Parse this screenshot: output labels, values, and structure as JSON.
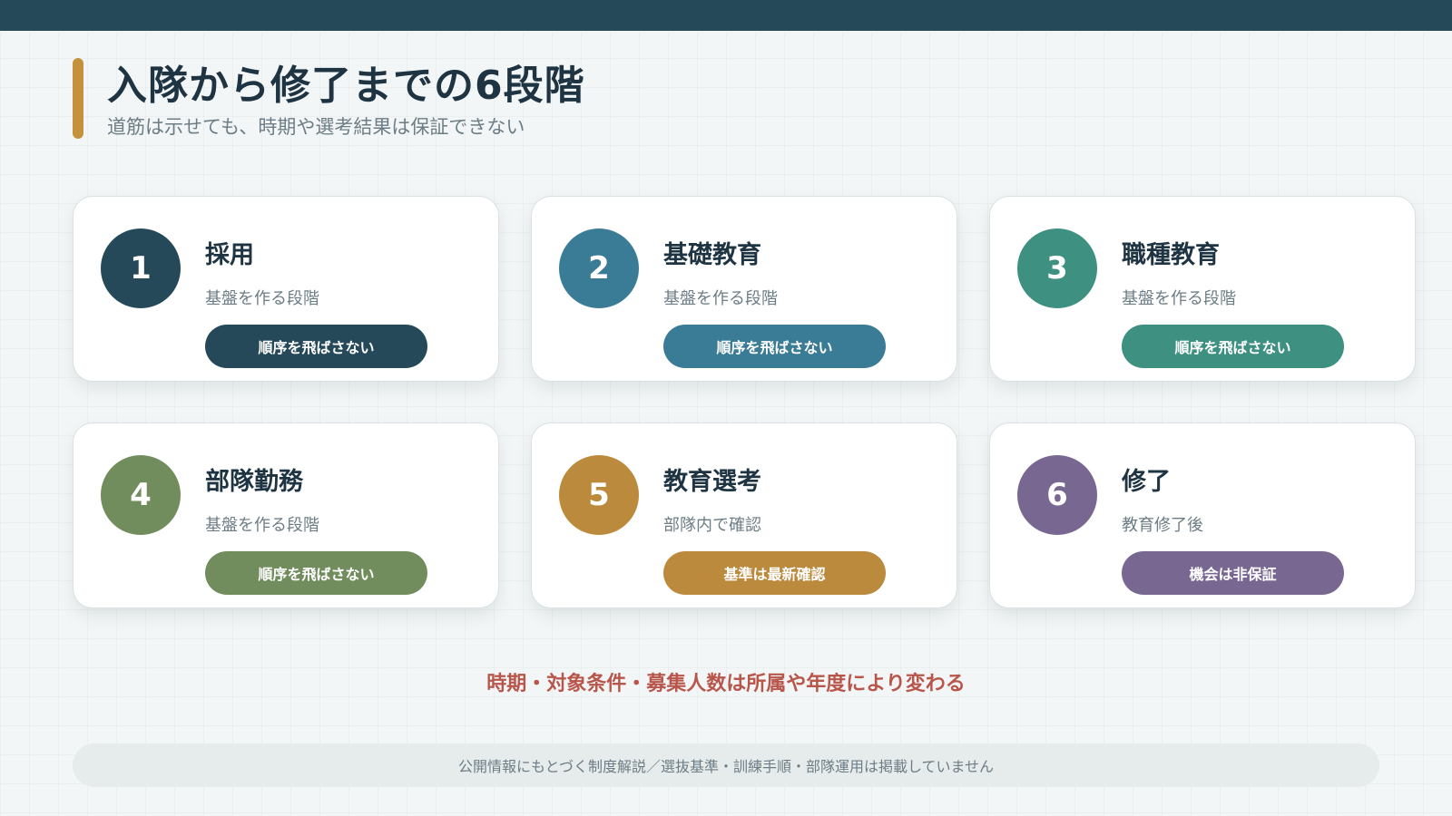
{
  "header": {
    "title": "入隊から修了までの6段階",
    "subtitle": "道筋は示せても、時期や選考結果は保証できない"
  },
  "colors": {
    "top_bar": "#26495a",
    "title_accent": "#c4913c",
    "warning_text": "#b8564b"
  },
  "stages": [
    {
      "number": "1",
      "title": "採用",
      "description": "基盤を作る段階",
      "badge": "順序を飛ばさない",
      "color": "#26495a"
    },
    {
      "number": "2",
      "title": "基礎教育",
      "description": "基盤を作る段階",
      "badge": "順序を飛ばさない",
      "color": "#3a7b96"
    },
    {
      "number": "3",
      "title": "職種教育",
      "description": "基盤を作る段階",
      "badge": "順序を飛ばさない",
      "color": "#3e9080"
    },
    {
      "number": "4",
      "title": "部隊勤務",
      "description": "基盤を作る段階",
      "badge": "順序を飛ばさない",
      "color": "#728d5d"
    },
    {
      "number": "5",
      "title": "教育選考",
      "description": "部隊内で確認",
      "badge": "基準は最新確認",
      "color": "#bb8a3d"
    },
    {
      "number": "6",
      "title": "修了",
      "description": "教育修了後",
      "badge": "機会は非保証",
      "color": "#786891"
    }
  ],
  "warning": "時期・対象条件・募集人数は所属や年度により変わる",
  "footnote": "公開情報にもとづく制度解説／選抜基準・訓練手順・部隊運用は掲載していません"
}
